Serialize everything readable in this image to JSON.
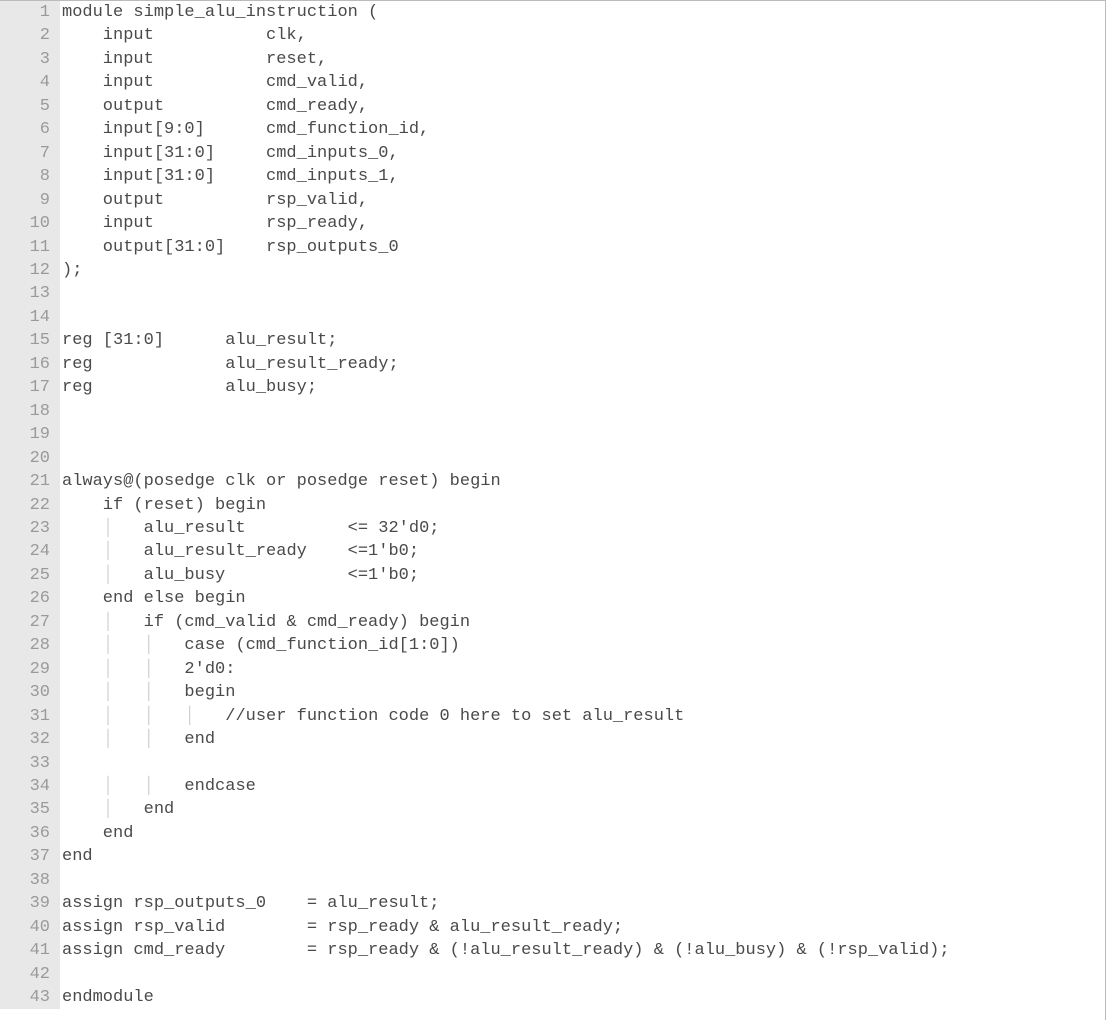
{
  "lines": [
    {
      "n": 1,
      "text": "module simple_alu_instruction ("
    },
    {
      "n": 2,
      "text": "    input           clk,"
    },
    {
      "n": 3,
      "text": "    input           reset,"
    },
    {
      "n": 4,
      "text": "    input           cmd_valid,"
    },
    {
      "n": 5,
      "text": "    output          cmd_ready,"
    },
    {
      "n": 6,
      "text": "    input[9:0]      cmd_function_id,"
    },
    {
      "n": 7,
      "text": "    input[31:0]     cmd_inputs_0,"
    },
    {
      "n": 8,
      "text": "    input[31:0]     cmd_inputs_1,"
    },
    {
      "n": 9,
      "text": "    output          rsp_valid,"
    },
    {
      "n": 10,
      "text": "    input           rsp_ready,"
    },
    {
      "n": 11,
      "text": "    output[31:0]    rsp_outputs_0"
    },
    {
      "n": 12,
      "text": ");"
    },
    {
      "n": 13,
      "text": ""
    },
    {
      "n": 14,
      "text": ""
    },
    {
      "n": 15,
      "text": "reg [31:0]      alu_result;"
    },
    {
      "n": 16,
      "text": "reg             alu_result_ready;"
    },
    {
      "n": 17,
      "text": "reg             alu_busy;"
    },
    {
      "n": 18,
      "text": ""
    },
    {
      "n": 19,
      "text": ""
    },
    {
      "n": 20,
      "text": ""
    },
    {
      "n": 21,
      "text": "always@(posedge clk or posedge reset) begin"
    },
    {
      "n": 22,
      "text": "    if (reset) begin"
    },
    {
      "n": 23,
      "text": "        alu_result          <= 32'd0;"
    },
    {
      "n": 24,
      "text": "        alu_result_ready    <=1'b0;"
    },
    {
      "n": 25,
      "text": "        alu_busy            <=1'b0;"
    },
    {
      "n": 26,
      "text": "    end else begin"
    },
    {
      "n": 27,
      "text": "        if (cmd_valid & cmd_ready) begin"
    },
    {
      "n": 28,
      "text": "            case (cmd_function_id[1:0])"
    },
    {
      "n": 29,
      "text": "            2'd0:"
    },
    {
      "n": 30,
      "text": "            begin"
    },
    {
      "n": 31,
      "text": "                //user function code 0 here to set alu_result"
    },
    {
      "n": 32,
      "text": "            end"
    },
    {
      "n": 33,
      "text": ""
    },
    {
      "n": 34,
      "text": "            endcase"
    },
    {
      "n": 35,
      "text": "        end"
    },
    {
      "n": 36,
      "text": "    end"
    },
    {
      "n": 37,
      "text": "end"
    },
    {
      "n": 38,
      "text": ""
    },
    {
      "n": 39,
      "text": "assign rsp_outputs_0    = alu_result;"
    },
    {
      "n": 40,
      "text": "assign rsp_valid        = rsp_ready & alu_result_ready;"
    },
    {
      "n": 41,
      "text": "assign cmd_ready        = rsp_ready & (!alu_result_ready) & (!alu_busy) & (!rsp_valid);"
    },
    {
      "n": 42,
      "text": ""
    },
    {
      "n": 43,
      "text": "endmodule"
    }
  ],
  "guide_cols": {
    "22": [
      4
    ],
    "23": [
      4,
      8
    ],
    "24": [
      4,
      8
    ],
    "25": [
      4,
      8
    ],
    "27": [
      4,
      8
    ],
    "28": [
      4,
      8,
      12
    ],
    "29": [
      4,
      8,
      12
    ],
    "30": [
      4,
      8,
      12
    ],
    "31": [
      4,
      8,
      12,
      16
    ],
    "32": [
      4,
      8,
      12
    ],
    "33": [
      4,
      8,
      12
    ],
    "34": [
      4,
      8,
      12
    ],
    "35": [
      4,
      8
    ],
    "36": [
      4
    ]
  }
}
